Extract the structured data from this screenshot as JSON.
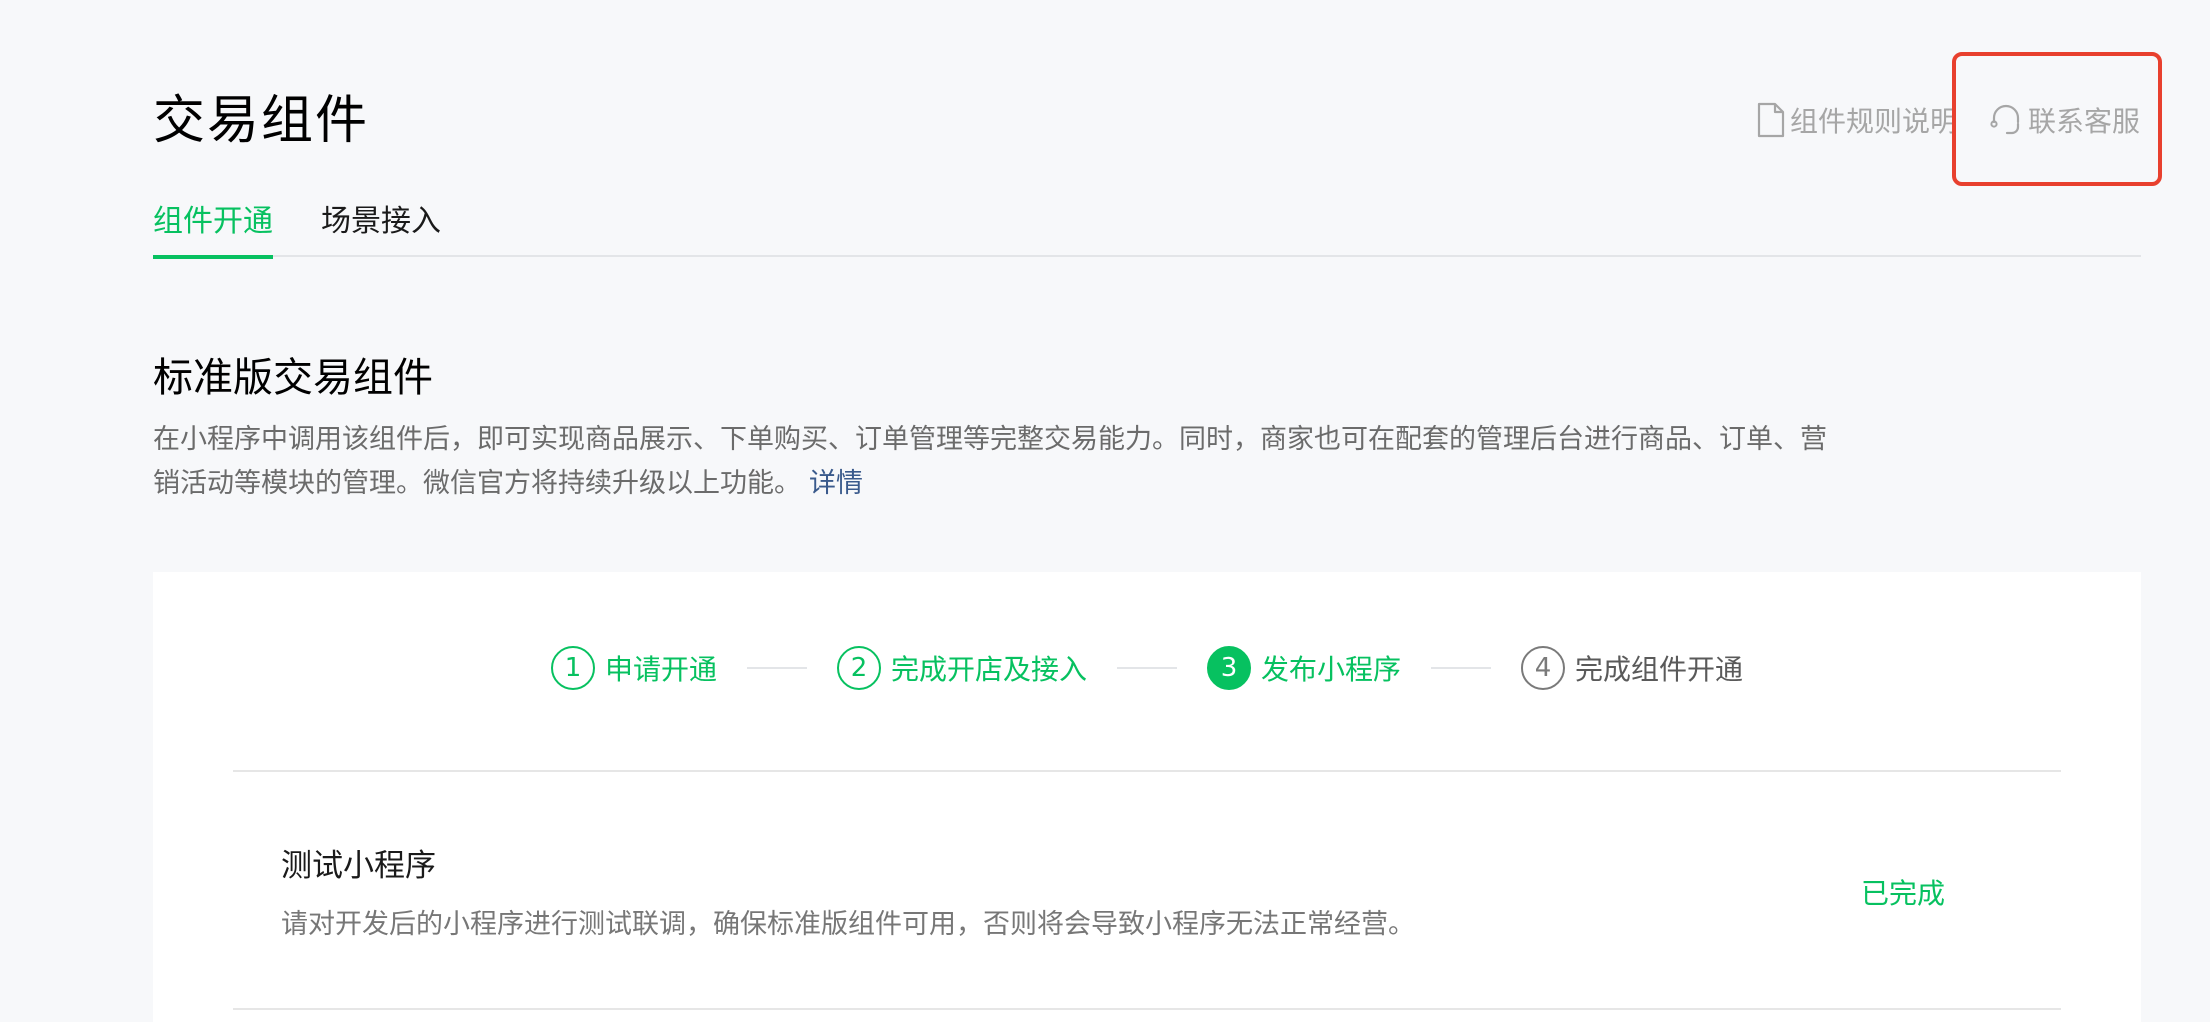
{
  "page": {
    "title": "交易组件"
  },
  "header": {
    "rules_link": "组件规则说明",
    "service_link": "联系客服"
  },
  "tabs": [
    {
      "label": "组件开通",
      "active": true
    },
    {
      "label": "场景接入",
      "active": false
    }
  ],
  "section": {
    "title": "标准版交易组件",
    "description": "在小程序中调用该组件后，即可实现商品展示、下单购买、订单管理等完整交易能力。同时，商家也可在配套的管理后台进行商品、订单、营销活动等模块的管理。微信官方将持续升级以上功能。",
    "detail_link": "详情"
  },
  "steps": [
    {
      "num": "1",
      "label": "申请开通",
      "state": "done"
    },
    {
      "num": "2",
      "label": "完成开店及接入",
      "state": "done"
    },
    {
      "num": "3",
      "label": "发布小程序",
      "state": "current"
    },
    {
      "num": "4",
      "label": "完成组件开通",
      "state": "todo"
    }
  ],
  "task": {
    "title": "测试小程序",
    "description": "请对开发后的小程序进行测试联调，确保标准版组件可用，否则将会导致小程序无法正常经营。",
    "status": "已完成"
  },
  "colors": {
    "accent": "#07c160",
    "highlight": "#e8402e",
    "link": "#3a5a8c"
  },
  "icons": {
    "rules": "document-icon",
    "service": "headset-icon"
  }
}
